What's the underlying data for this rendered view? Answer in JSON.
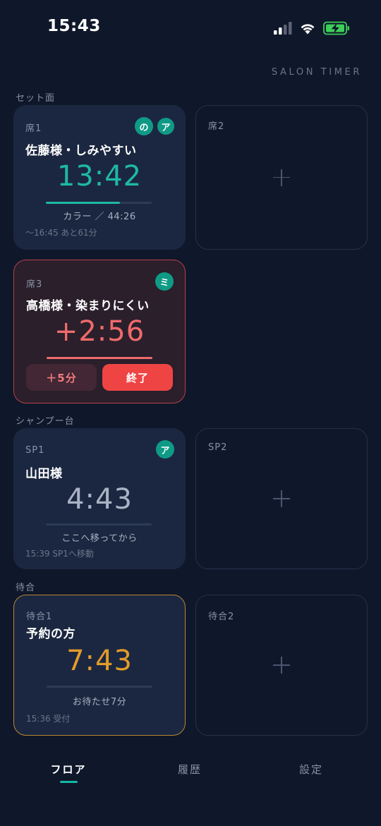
{
  "status_bar": {
    "time": "15:43"
  },
  "brand": "SALON TIMER",
  "colors": {
    "accent": "#14b8a6",
    "overtime": "#ef4444",
    "waiting": "#f59e0b",
    "background": "#0f172a"
  },
  "sections": {
    "cut": {
      "label": "セット面",
      "seat1": {
        "label": "席1",
        "badges": [
          "の",
          "ア"
        ],
        "customer": "佐藤様・しみやすい",
        "timer": "13:42",
        "progress": 0.7,
        "caption": "カラー ／ 44:26",
        "footnote": "〜16:45 あと61分"
      },
      "seat2": {
        "label": "席2"
      },
      "seat3": {
        "label": "席3",
        "badges": [
          "ミ"
        ],
        "customer": "高橋様・染まりにくい",
        "timer": "+2:56",
        "progress": 1.0,
        "extend_label": "＋5分",
        "finish_label": "終了"
      }
    },
    "shampoo": {
      "label": "シャンプー台",
      "sp1": {
        "label": "SP1",
        "badges": [
          "ア"
        ],
        "customer": "山田様",
        "timer": "4:43",
        "progress": 0,
        "caption": "ここへ移ってから",
        "footnote": "15:39 SP1へ移動"
      },
      "sp2": {
        "label": "SP2"
      }
    },
    "waiting": {
      "label": "待合",
      "wait1": {
        "label": "待合1",
        "customer": "予約の方",
        "timer": "7:43",
        "progress": 0,
        "caption": "お待たせ7分",
        "footnote": "15:36 受付"
      },
      "wait2": {
        "label": "待合2"
      }
    }
  },
  "tabs": [
    {
      "label": "フロア",
      "active": true
    },
    {
      "label": "履歴",
      "active": false
    },
    {
      "label": "設定",
      "active": false
    }
  ]
}
